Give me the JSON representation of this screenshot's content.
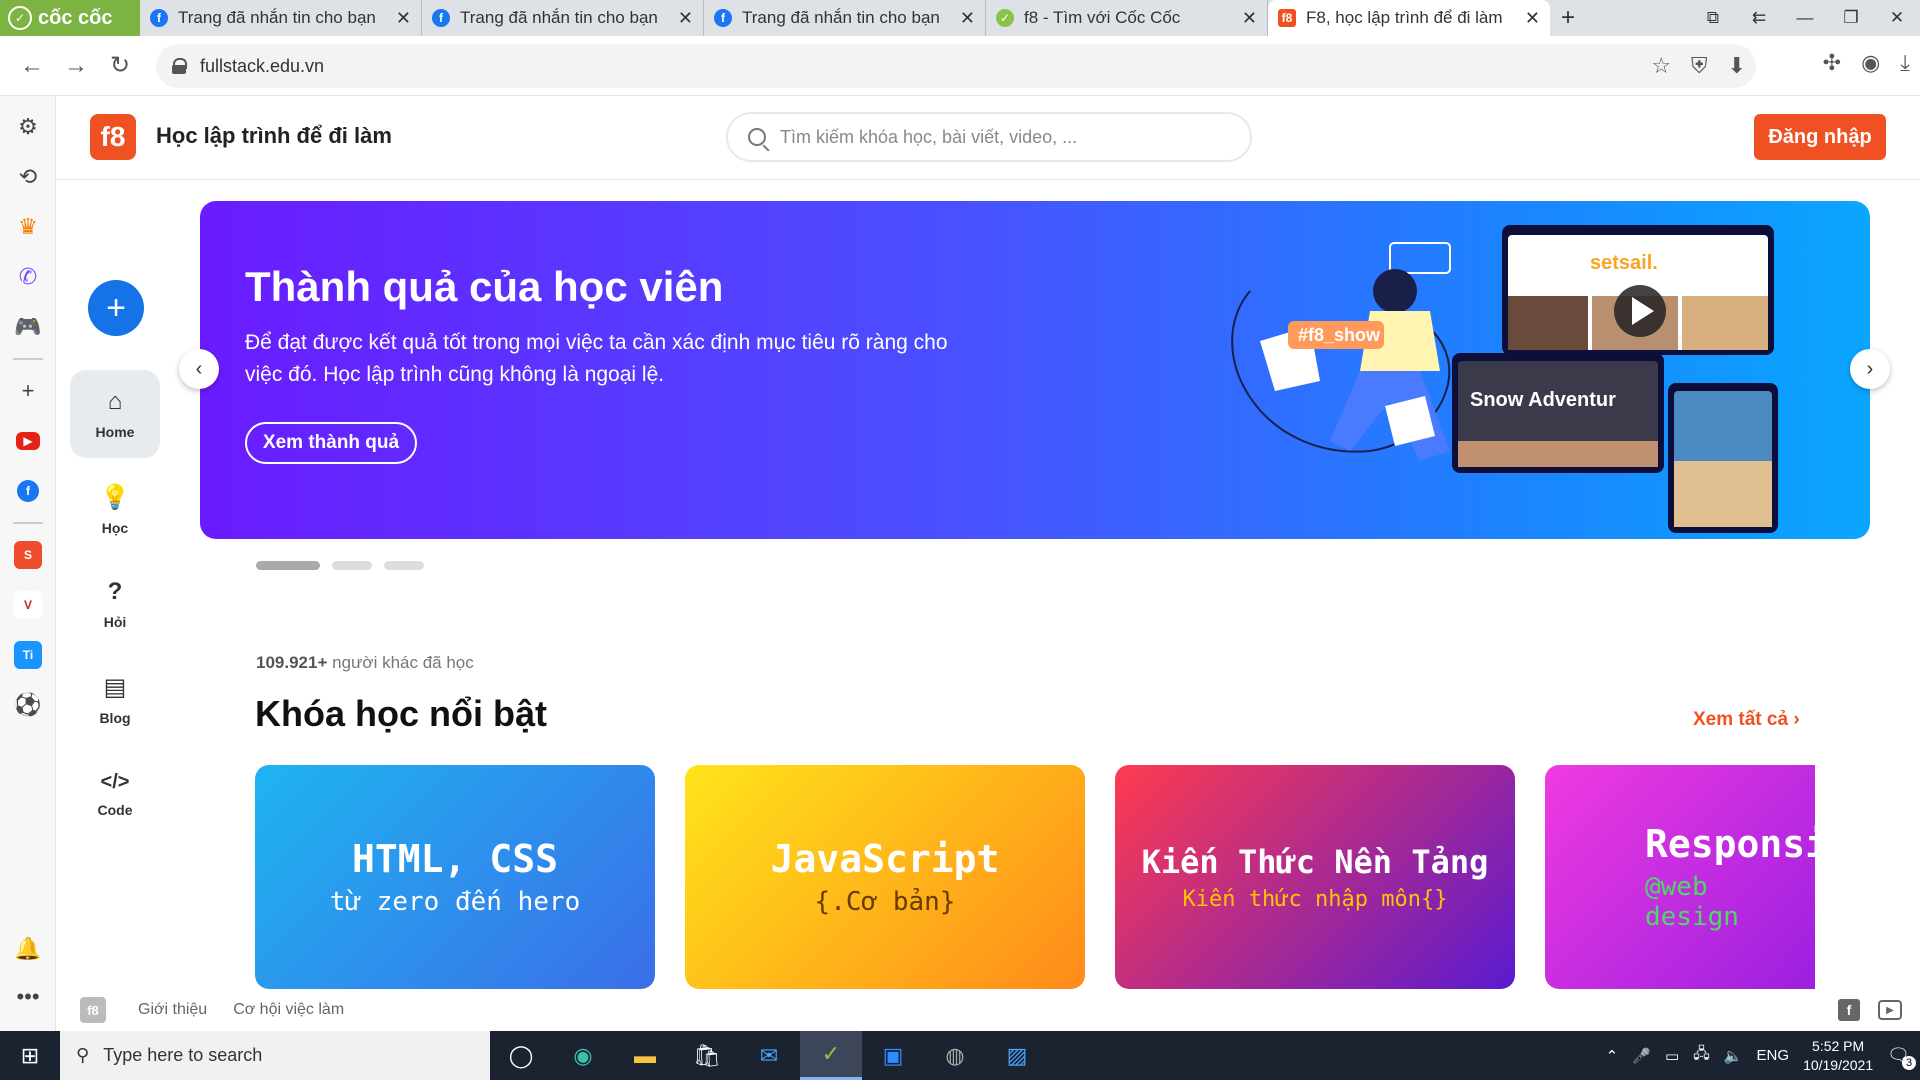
{
  "browser": {
    "brand": "cốc cốc",
    "tabs": [
      {
        "title": "Trang đã nhắn tin cho bạn",
        "icon": "facebook-icon"
      },
      {
        "title": "Trang đã nhắn tin cho bạn",
        "icon": "facebook-icon"
      },
      {
        "title": "Trang đã nhắn tin cho bạn",
        "icon": "facebook-icon"
      },
      {
        "title": "f8 - Tìm với Cốc Cốc",
        "icon": "coccoc-icon"
      },
      {
        "title": "F8, học lập trình để đi làm",
        "icon": "f8-icon",
        "active": true
      }
    ],
    "url": "fullstack.edu.vn"
  },
  "site": {
    "logo": "f8",
    "title": "Học lập trình để đi làm",
    "search_placeholder": "Tìm kiếm khóa học, bài viết, video, ...",
    "login": "Đăng nhập"
  },
  "rail": {
    "items": [
      {
        "label": "Home",
        "icon": "home-icon",
        "active": true
      },
      {
        "label": "Học",
        "icon": "lightbulb-icon"
      },
      {
        "label": "Hỏi",
        "icon": "question-icon"
      },
      {
        "label": "Blog",
        "icon": "newspaper-icon"
      },
      {
        "label": "Code",
        "icon": "code-icon"
      }
    ]
  },
  "banner": {
    "title": "Thành quả của học viên",
    "text": "Để đạt được kết quả tốt trong mọi việc ta cần xác định mục tiêu rõ ràng cho việc đó. Học lập trình cũng không là ngoại lệ.",
    "button": "Xem thành quả",
    "tag": "#f8_show",
    "site1": "setsail.",
    "site2": "Snow Adventur"
  },
  "courses": {
    "learners_count": "109.921+",
    "learners_text": "người khác đã học",
    "heading": "Khóa học nổi bật",
    "view_all": "Xem tất cả",
    "cards": [
      {
        "title": "HTML, CSS",
        "subtitle": "từ zero đến hero"
      },
      {
        "title": "JavaScript",
        "subtitle": "{.Cơ bản}"
      },
      {
        "title": "Kiến Thức Nền Tảng",
        "subtitle": "Kiến thức nhập môn{}"
      },
      {
        "title": "Responsiv",
        "subtitle": "@web design"
      }
    ]
  },
  "footer": {
    "logo": "f8",
    "links": [
      "Giới thiệu",
      "Cơ hội việc làm"
    ]
  },
  "taskbar": {
    "search_placeholder": "Type here to search",
    "lang": "ENG",
    "time": "5:52 PM",
    "date": "10/19/2021",
    "notif_count": "3"
  },
  "colors": {
    "accent": "#f05123",
    "primary_blue": "#1473e6"
  }
}
